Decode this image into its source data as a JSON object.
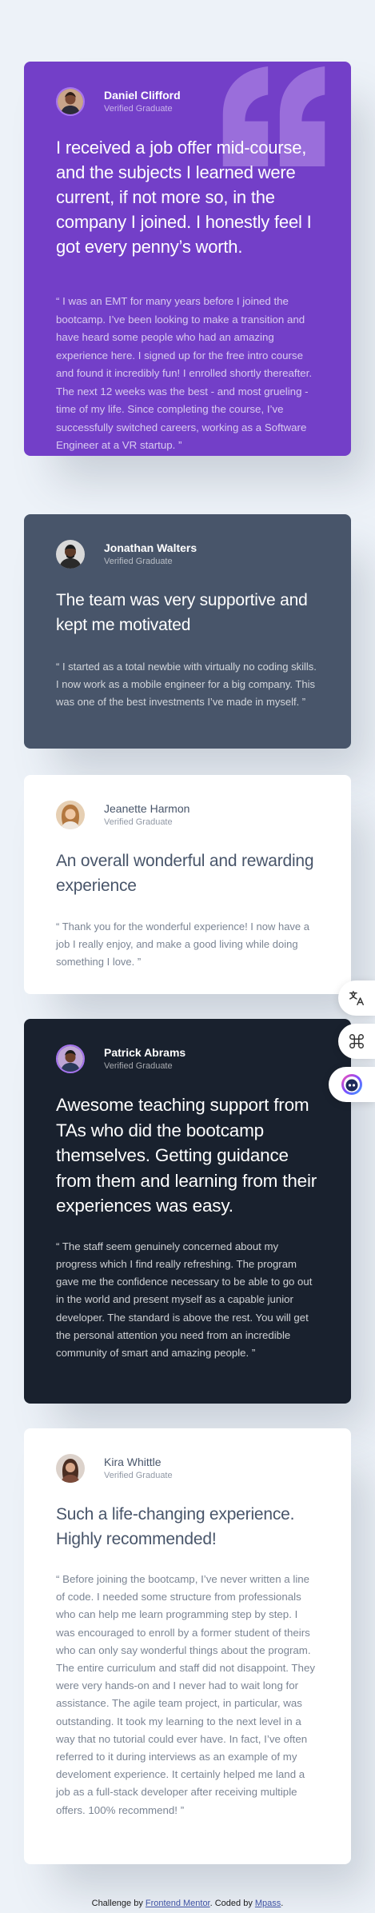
{
  "testimonials": [
    {
      "name": "Daniel Clifford",
      "role": "Verified Graduate",
      "headline": "I received a job offer mid-course, and the subjects I learned were current, if not more so, in the company I joined. I honestly feel I got every penny’s worth.",
      "body": "“ I was an EMT for many years before I joined the bootcamp. I’ve been looking to make a transition and have heard some people who had an amazing experience here. I signed up for the free intro course and found it incredibly fun! I enrolled shortly thereafter. The next 12 weeks was the best - and most grueling - time of my life. Since completing the course, I’ve successfully switched careers, working as a Software Engineer at a VR startup. ”"
    },
    {
      "name": "Jonathan Walters",
      "role": "Verified Graduate",
      "headline": "The team was very supportive and kept me motivated",
      "body": "“ I started as a total newbie with virtually no coding skills. I now work as a mobile engineer for a big company. This was one of the best investments I’ve made in myself. ”"
    },
    {
      "name": "Jeanette Harmon",
      "role": "Verified Graduate",
      "headline": "An overall wonderful and rewarding experience",
      "body": "“ Thank you for the wonderful experience! I now have a job I really enjoy, and make a good living while doing something I love. ”"
    },
    {
      "name": "Patrick Abrams",
      "role": "Verified Graduate",
      "headline": "Awesome teaching support from TAs who did the bootcamp themselves. Getting guidance from them and learning from their experiences was easy.",
      "body": "“ The staff seem genuinely concerned about my progress which I find really refreshing. The program gave me the confidence necessary to be able to go out in the world and present myself as a capable junior developer. The standard is above the rest. You will get the personal attention you need from an incredible community of smart and amazing people. ”"
    },
    {
      "name": "Kira Whittle",
      "role": "Verified Graduate",
      "headline": "Such a life-changing experience. Highly recommended!",
      "body": "“ Before joining the bootcamp, I’ve never written a line of code. I needed some structure from professionals who can help me learn programming step by step. I was encouraged to enroll by a former student of theirs who can only say wonderful things about the program. The entire curriculum and staff did not disappoint. They were very hands-on and I never had to wait long for assistance. The agile team project, in particular, was outstanding. It took my learning to the next level in a way that no tutorial could ever have. In fact, I’ve often referred to it during interviews as an example of my develoment experience. It certainly helped me land a job as a full-stack developer after receiving multiple offers. 100% recommend! ”"
    }
  ],
  "attribution": {
    "prefix": "Challenge by ",
    "link1": "Frontend Mentor",
    "middle": ". Coded by ",
    "link2": "Mpass",
    "suffix": "."
  },
  "side_tools": [
    {
      "icon": "translate-icon"
    },
    {
      "icon": "command-icon"
    },
    {
      "icon": "assistant-icon"
    }
  ],
  "colors": {
    "purple": "#733fc8",
    "slate": "#48556a",
    "white": "#ffffff",
    "dark": "#19212e",
    "background": "#edf2f8"
  }
}
